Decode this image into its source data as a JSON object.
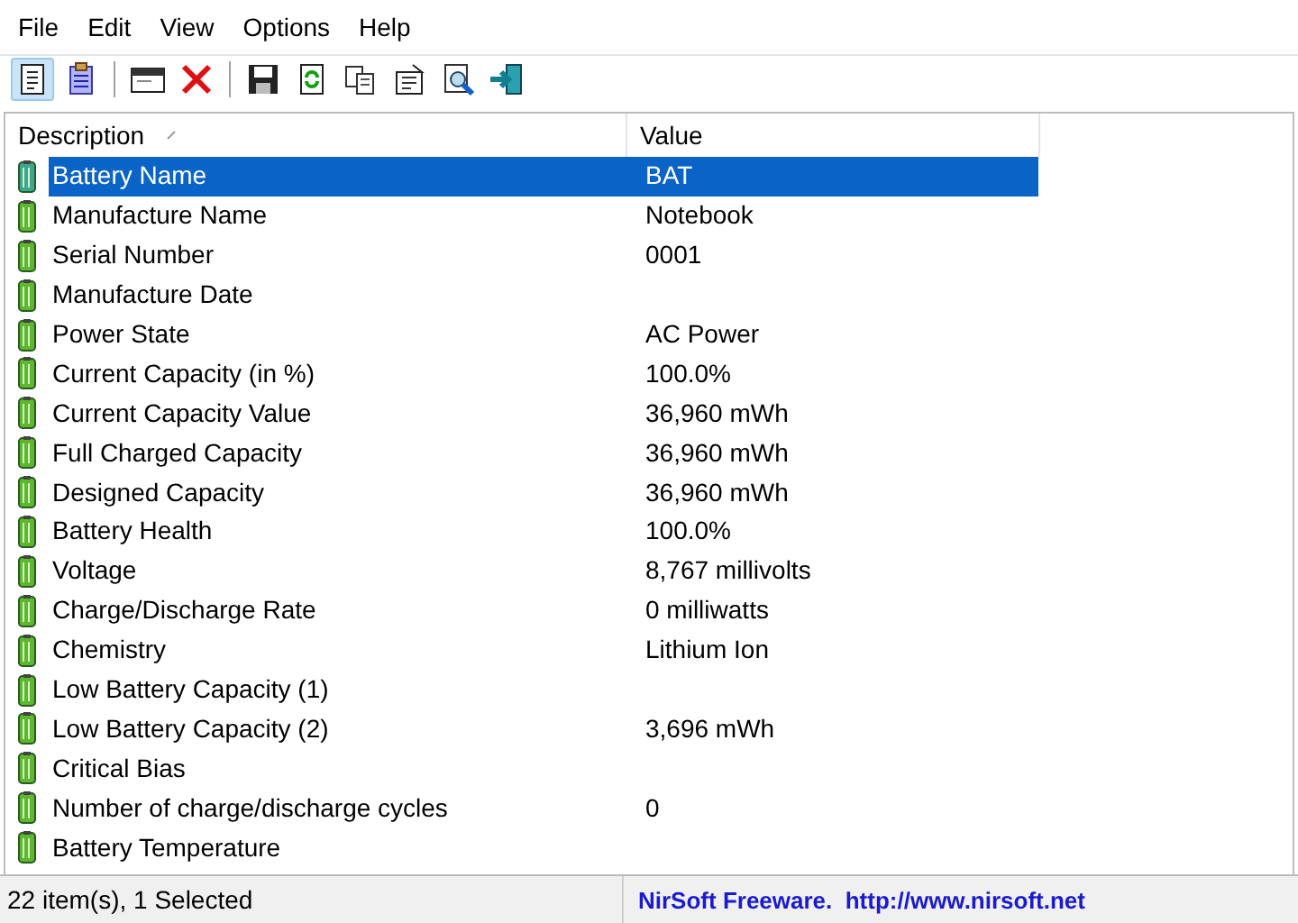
{
  "menu": [
    "File",
    "Edit",
    "View",
    "Options",
    "Help"
  ],
  "toolbar": [
    {
      "kind": "report",
      "pressed": true
    },
    {
      "kind": "clipboard",
      "pressed": false
    },
    {
      "kind": "sep"
    },
    {
      "kind": "window",
      "pressed": false
    },
    {
      "kind": "delete",
      "pressed": false
    },
    {
      "kind": "sep"
    },
    {
      "kind": "save",
      "pressed": false
    },
    {
      "kind": "refresh",
      "pressed": false
    },
    {
      "kind": "copy",
      "pressed": false
    },
    {
      "kind": "properties",
      "pressed": false
    },
    {
      "kind": "find",
      "pressed": false
    },
    {
      "kind": "exit",
      "pressed": false
    }
  ],
  "table": {
    "columns": [
      "Description",
      "Value"
    ],
    "rows": [
      {
        "description": "Battery Name",
        "value": "BAT",
        "selected": true
      },
      {
        "description": "Manufacture Name",
        "value": "Notebook",
        "selected": false
      },
      {
        "description": "Serial Number",
        "value": "0001",
        "selected": false
      },
      {
        "description": "Manufacture Date",
        "value": "",
        "selected": false
      },
      {
        "description": "Power State",
        "value": "AC Power",
        "selected": false
      },
      {
        "description": "Current Capacity (in %)",
        "value": "100.0%",
        "selected": false
      },
      {
        "description": "Current Capacity Value",
        "value": "36,960 mWh",
        "selected": false
      },
      {
        "description": "Full Charged Capacity",
        "value": "36,960 mWh",
        "selected": false
      },
      {
        "description": "Designed Capacity",
        "value": "36,960 mWh",
        "selected": false
      },
      {
        "description": "Battery Health",
        "value": "100.0%",
        "selected": false
      },
      {
        "description": "Voltage",
        "value": "8,767 millivolts",
        "selected": false
      },
      {
        "description": "Charge/Discharge Rate",
        "value": "0 milliwatts",
        "selected": false
      },
      {
        "description": "Chemistry",
        "value": "Lithium Ion",
        "selected": false
      },
      {
        "description": "Low Battery Capacity (1)",
        "value": "",
        "selected": false
      },
      {
        "description": "Low Battery Capacity (2)",
        "value": "3,696 mWh",
        "selected": false
      },
      {
        "description": "Critical Bias",
        "value": "",
        "selected": false
      },
      {
        "description": "Number of charge/discharge cycles",
        "value": "0",
        "selected": false
      },
      {
        "description": "Battery Temperature",
        "value": "",
        "selected": false
      }
    ]
  },
  "status_bar": {
    "count": "22 item(s), 1 Selected",
    "credit": "NirSoft Freeware.  http://www.nirsoft.net"
  }
}
